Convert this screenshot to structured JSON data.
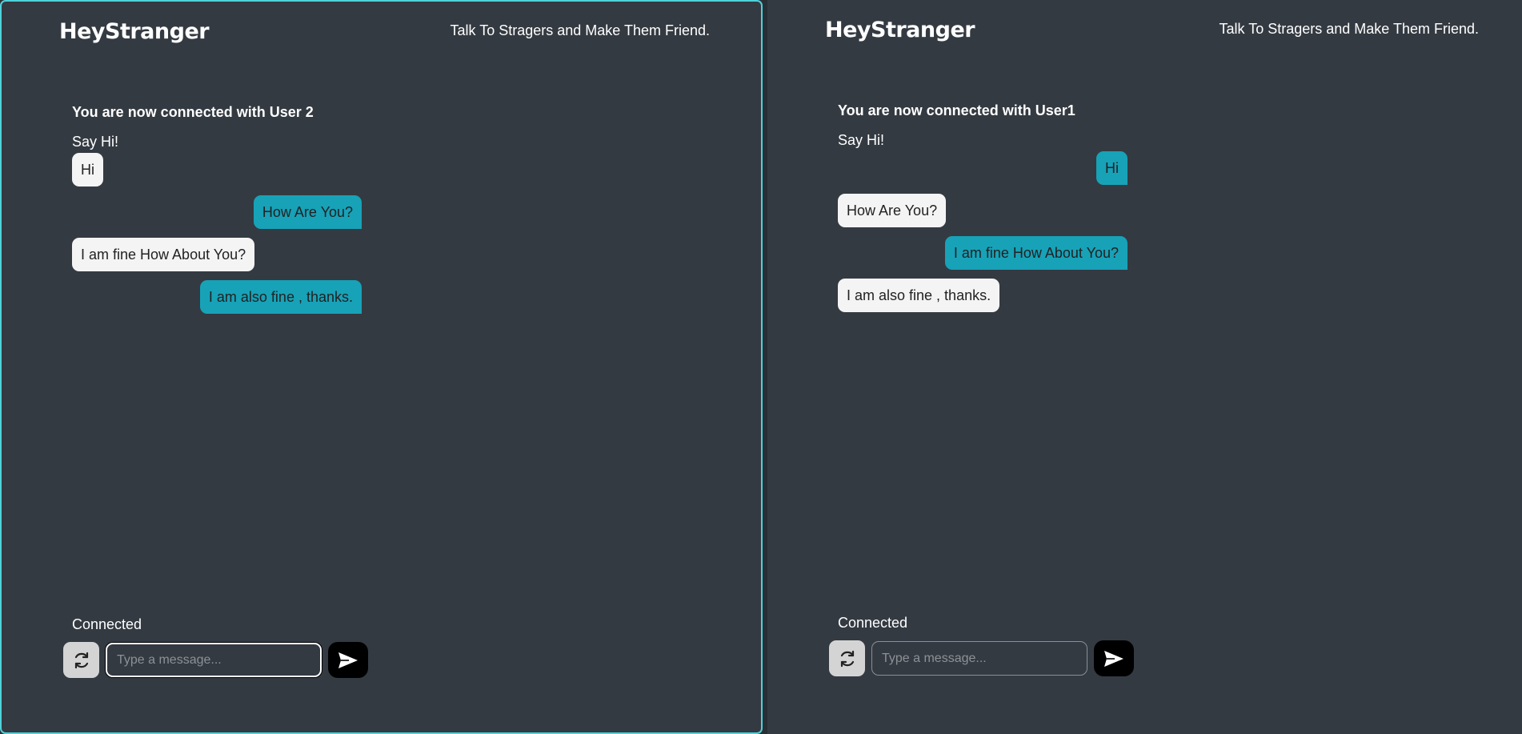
{
  "panes": [
    {
      "brand": "HeyStranger",
      "tagline": "Talk To Stragers and Make Them Friend.",
      "connected_title": "You are now connected with User 2",
      "prompt": "Say Hi!",
      "messages": [
        {
          "text": "Hi",
          "dir": "in"
        },
        {
          "text": "How Are You?",
          "dir": "out"
        },
        {
          "text": "I am fine How About You?",
          "dir": "in"
        },
        {
          "text": "I am also fine , thanks.",
          "dir": "out"
        }
      ],
      "status": "Connected",
      "input_placeholder": "Type a message...",
      "input_value": ""
    },
    {
      "brand": "HeyStranger",
      "tagline": "Talk To Stragers and Make Them Friend.",
      "connected_title": "You are now connected with User1",
      "prompt": "Say Hi!",
      "messages": [
        {
          "text": "Hi",
          "dir": "out"
        },
        {
          "text": "How Are You?",
          "dir": "in"
        },
        {
          "text": "I am fine How About You?",
          "dir": "out"
        },
        {
          "text": "I am also fine , thanks.",
          "dir": "in"
        }
      ],
      "status": "Connected",
      "input_placeholder": "Type a message...",
      "input_value": ""
    }
  ],
  "icons": {
    "refresh": "refresh-icon",
    "send": "send-icon"
  },
  "colors": {
    "accent": "#17a2b8",
    "incoming_bubble": "#f4f4f4",
    "pane_bg": "#343a42",
    "focus_border": "#4fd1d9"
  }
}
